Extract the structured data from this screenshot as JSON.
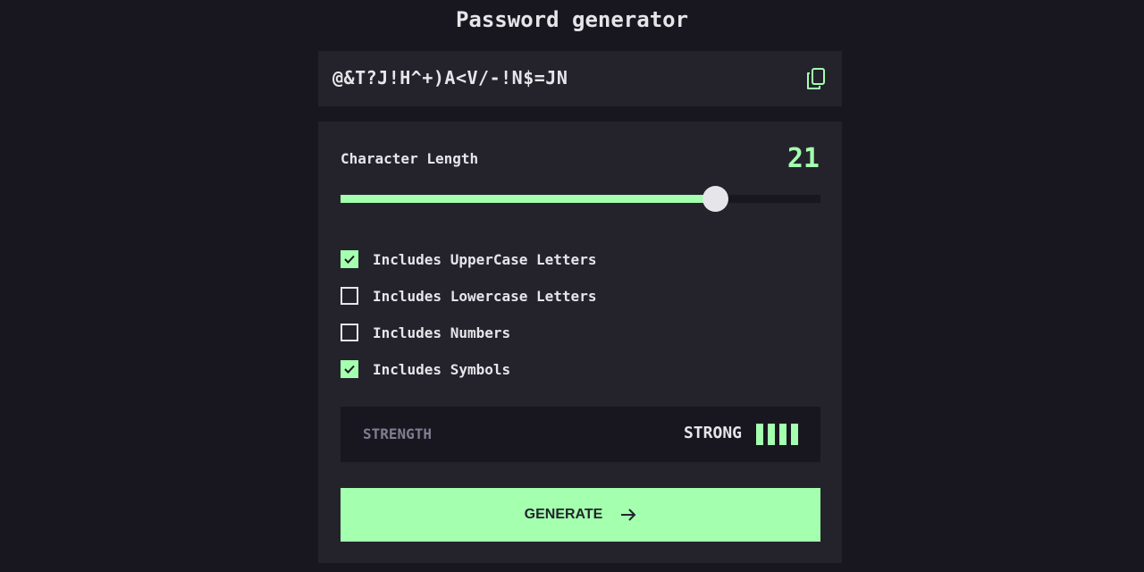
{
  "app": {
    "title": "Password generator"
  },
  "output": {
    "password": "@&T?J!H^+)A<V/-!N$=JN",
    "copy_icon": "copy-icon"
  },
  "length": {
    "label": "Character Length",
    "value": "21",
    "slider_fraction": 0.78
  },
  "options": [
    {
      "label": "Includes UpperCase Letters",
      "checked": true
    },
    {
      "label": "Includes Lowercase Letters",
      "checked": false
    },
    {
      "label": "Includes Numbers",
      "checked": false
    },
    {
      "label": "Includes Symbols",
      "checked": true
    }
  ],
  "strength": {
    "label": "STRENGTH",
    "value": "STRONG",
    "level": 4,
    "max_level": 4
  },
  "generate": {
    "label": "GENERATE",
    "icon": "arrow-right-icon"
  },
  "colors": {
    "accent": "#a4ffaf",
    "background": "#18171f",
    "panel": "#24232c",
    "text": "#e6e5ea",
    "muted": "#817d92"
  }
}
